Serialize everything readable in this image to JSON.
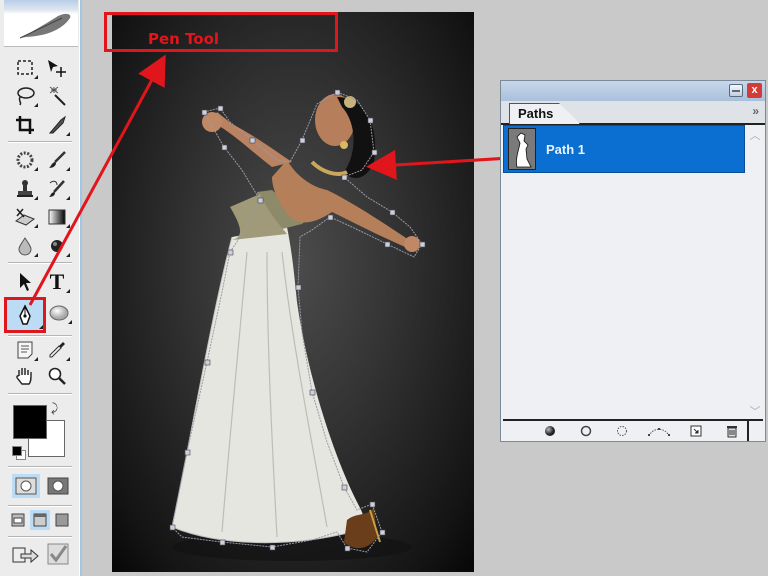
{
  "annotation": {
    "label": "Pen Tool",
    "color": "#e0161c"
  },
  "toolbox": {
    "tools": [
      {
        "name": "rectangular-marquee-tool",
        "icon": "marquee-icon"
      },
      {
        "name": "move-tool",
        "icon": "move-icon"
      },
      {
        "name": "lasso-tool",
        "icon": "lasso-icon"
      },
      {
        "name": "magic-wand-tool",
        "icon": "magic-wand-icon"
      },
      {
        "name": "crop-tool",
        "icon": "crop-icon"
      },
      {
        "name": "slice-tool",
        "icon": "slice-icon"
      },
      {
        "name": "healing-brush-tool",
        "icon": "healing-icon"
      },
      {
        "name": "brush-tool",
        "icon": "brush-icon"
      },
      {
        "name": "clone-stamp-tool",
        "icon": "stamp-icon"
      },
      {
        "name": "history-brush-tool",
        "icon": "history-brush-icon"
      },
      {
        "name": "eraser-tool",
        "icon": "eraser-icon"
      },
      {
        "name": "gradient-tool",
        "icon": "gradient-icon"
      },
      {
        "name": "blur-tool",
        "icon": "blur-icon"
      },
      {
        "name": "dodge-tool",
        "icon": "dodge-icon"
      },
      {
        "name": "path-selection-tool",
        "icon": "arrow-icon"
      },
      {
        "name": "type-tool",
        "icon": "type-icon",
        "glyph": "T"
      },
      {
        "name": "pen-tool",
        "icon": "pen-icon",
        "active": true
      },
      {
        "name": "shape-tool",
        "icon": "ellipse-icon"
      },
      {
        "name": "notes-tool",
        "icon": "notes-icon"
      },
      {
        "name": "eyedropper-tool",
        "icon": "eyedropper-icon"
      },
      {
        "name": "hand-tool",
        "icon": "hand-icon"
      },
      {
        "name": "zoom-tool",
        "icon": "zoom-icon"
      }
    ],
    "foreground_color": "#000000",
    "background_color": "#ffffff"
  },
  "paths_panel": {
    "tab_label": "Paths",
    "menu_glyph": "»",
    "close_glyph": "x",
    "selected_color": "#0b6fd1",
    "paths": [
      {
        "label": "Path 1",
        "selected": true
      }
    ],
    "footer_buttons": [
      "fill-path-button",
      "stroke-path-button",
      "load-as-selection-button",
      "make-work-path-button",
      "new-path-button",
      "delete-path-button"
    ]
  }
}
